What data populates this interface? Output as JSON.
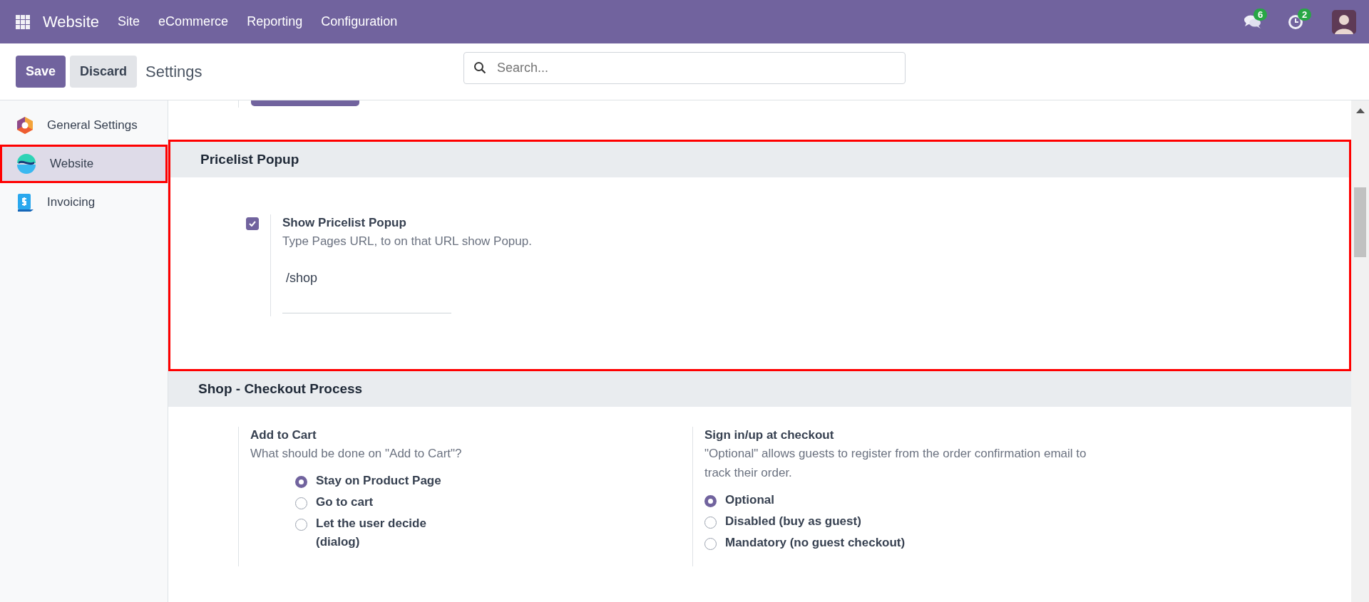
{
  "navbar": {
    "app_name": "Website",
    "menu": [
      "Site",
      "eCommerce",
      "Reporting",
      "Configuration"
    ],
    "messages_count": "6",
    "activities_count": "2"
  },
  "control_panel": {
    "buttons": [
      {
        "label": "Save",
        "kind": "primary"
      },
      {
        "label": "Discard",
        "kind": "secondary"
      }
    ],
    "title": "Settings",
    "search": {
      "placeholder": "Search..."
    }
  },
  "sidebar": {
    "items": [
      {
        "label": "General Settings",
        "kind": "general",
        "selected": false,
        "highlighted": false
      },
      {
        "label": "Website",
        "kind": "website",
        "selected": true,
        "highlighted": true
      },
      {
        "label": "Invoicing",
        "kind": "invoicing",
        "selected": false,
        "highlighted": false
      }
    ]
  },
  "sections": [
    {
      "title": "Pricelist Popup",
      "highlighted": true,
      "settings": [
        {
          "kind": "checkbox",
          "title": "Show Pricelist Popup",
          "checked": true,
          "description": "Type Pages URL, to on that URL show Popup.",
          "value": "/shop"
        }
      ]
    },
    {
      "title": "Shop - Checkout Process",
      "highlighted": false,
      "settings": [
        {
          "kind": "radio",
          "title": "Add to Cart",
          "description": "What should be done on \"Add to Cart\"?",
          "options": [
            {
              "label": "Stay on Product Page",
              "selected": true
            },
            {
              "label": "Go to cart",
              "selected": false
            },
            {
              "label": "Let the user decide (dialog)",
              "selected": false
            }
          ]
        },
        {
          "kind": "radio",
          "title": "Sign in/up at checkout",
          "description": "\"Optional\" allows guests to register from the order confirmation email to track their order.",
          "options": [
            {
              "label": "Optional",
              "selected": true
            },
            {
              "label": "Disabled (buy as guest)",
              "selected": false
            },
            {
              "label": "Mandatory (no guest checkout)",
              "selected": false
            }
          ]
        }
      ]
    }
  ]
}
